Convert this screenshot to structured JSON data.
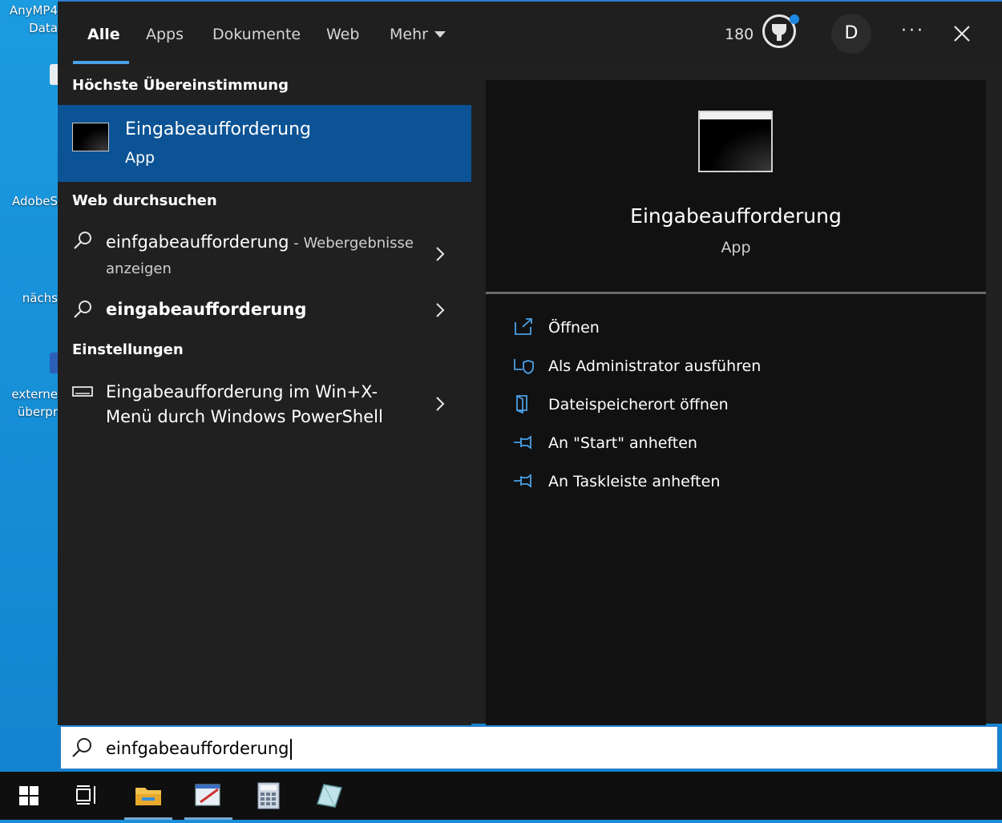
{
  "desktop": {
    "labels": [
      [
        "AnyMP4",
        "Data"
      ],
      [
        "AdobeS"
      ],
      [
        "nächs"
      ],
      [
        "externe",
        "überpr"
      ]
    ]
  },
  "header": {
    "tabs": [
      {
        "label": "Alle",
        "active": true
      },
      {
        "label": "Apps"
      },
      {
        "label": "Dokumente"
      },
      {
        "label": "Web"
      },
      {
        "label": "Mehr"
      }
    ],
    "points": "180",
    "avatar_initial": "D",
    "more_label": "···"
  },
  "left": {
    "best_match_heading": "Höchste Übereinstimmung",
    "best_match": {
      "title": "Eingabeaufforderung",
      "subtitle": "App"
    },
    "web_heading": "Web durchsuchen",
    "web_results": [
      {
        "query": "einfgabeaufforderung",
        "suffix": " - Webergebnisse anzeigen"
      },
      {
        "query": "eingabeaufforderung",
        "suffix": ""
      }
    ],
    "settings_heading": "Einstellungen",
    "settings_item": "Eingabeaufforderung im Win+X-Menü durch Windows PowerShell"
  },
  "preview": {
    "title": "Eingabeaufforderung",
    "subtitle": "App",
    "actions": [
      {
        "label": "Öffnen",
        "icon": "open-icon"
      },
      {
        "label": "Als Administrator ausführen",
        "icon": "shield-icon"
      },
      {
        "label": "Dateispeicherort öffnen",
        "icon": "folder-location-icon"
      },
      {
        "label": "An \"Start\" anheften",
        "icon": "pin-icon"
      },
      {
        "label": "An Taskleiste anheften",
        "icon": "pin-icon"
      }
    ]
  },
  "search": {
    "value": "einfgabeaufforderung"
  },
  "taskbar": {
    "items": [
      "start-icon",
      "task-view-icon",
      "file-explorer-icon",
      "editor-app-icon",
      "calculator-icon",
      "notes-app-icon"
    ]
  },
  "colors": {
    "accent": "#0b5394",
    "panel": "#202020",
    "preview": "#111111",
    "desktop": "#1b9be0"
  }
}
